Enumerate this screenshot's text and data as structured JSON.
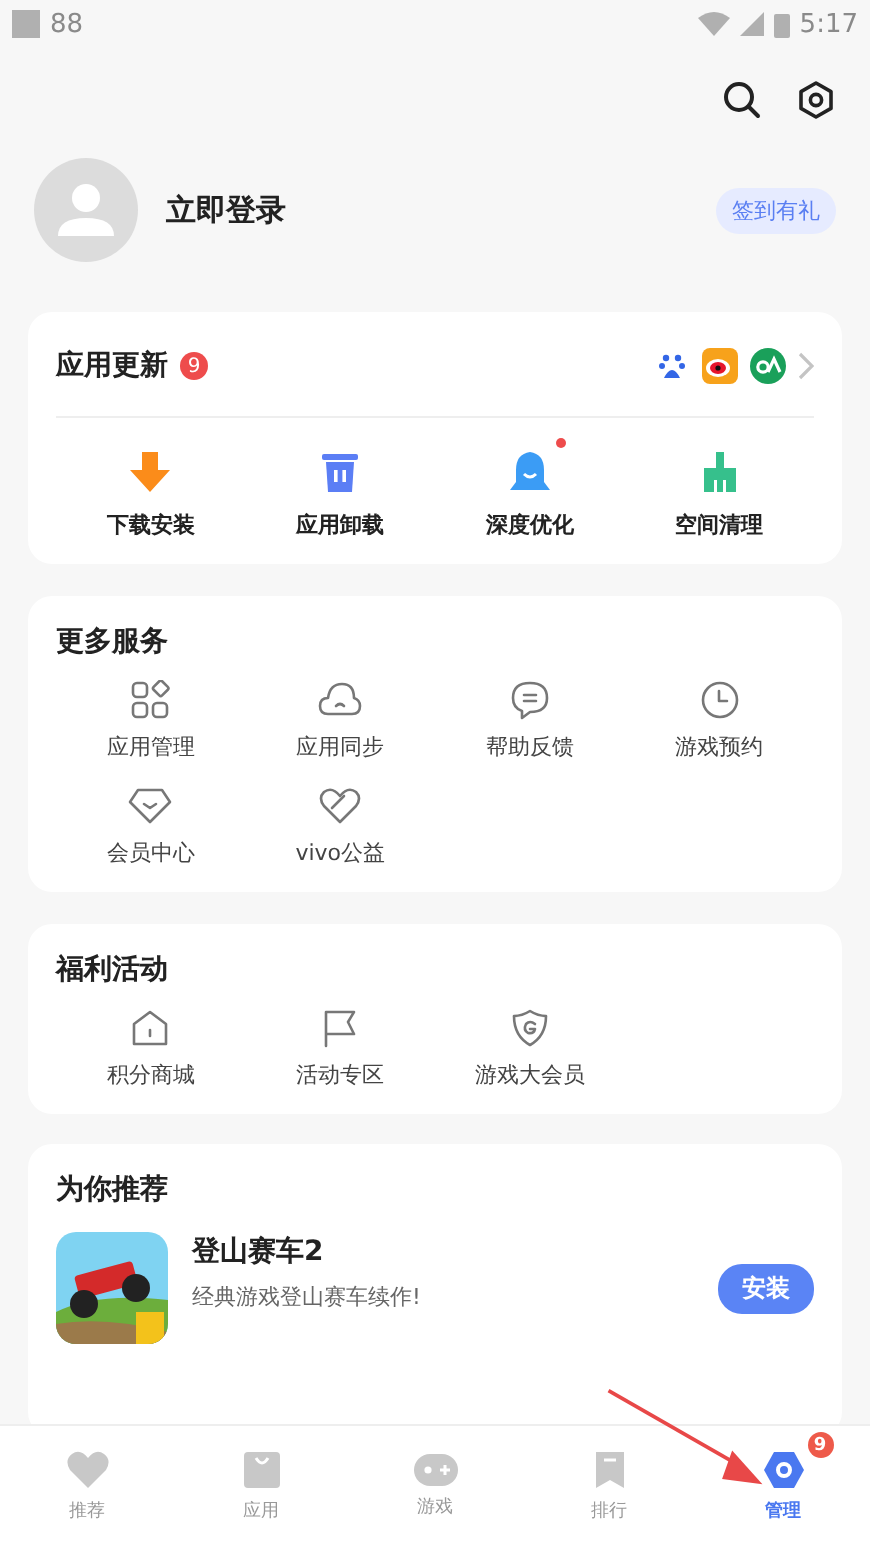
{
  "status_bar": {
    "notification": "88",
    "time": "5:17"
  },
  "profile": {
    "login": "立即登录",
    "checkin": "签到有礼"
  },
  "updates": {
    "title": "应用更新",
    "badge": "9",
    "tools": [
      {
        "label": "下载安装",
        "dot": false
      },
      {
        "label": "应用卸载",
        "dot": false
      },
      {
        "label": "深度优化",
        "dot": true
      },
      {
        "label": "空间清理",
        "dot": false
      }
    ]
  },
  "services": {
    "title": "更多服务",
    "items": [
      "应用管理",
      "应用同步",
      "帮助反馈",
      "游戏预约",
      "会员中心",
      "vivo公益"
    ]
  },
  "welfare": {
    "title": "福利活动",
    "items": [
      "积分商城",
      "活动专区",
      "游戏大会员"
    ]
  },
  "recommend": {
    "title": "为你推荐",
    "app": {
      "kind": "picture",
      "name": "登山赛车2",
      "desc": "经典游戏登山赛车续作!",
      "button": "安装"
    }
  },
  "tabs": [
    {
      "label": "推荐",
      "selected": false
    },
    {
      "label": "应用",
      "selected": false
    },
    {
      "label": "游戏",
      "selected": false
    },
    {
      "label": "排行",
      "selected": false
    },
    {
      "label": "管理",
      "selected": true,
      "badge": "9"
    }
  ]
}
